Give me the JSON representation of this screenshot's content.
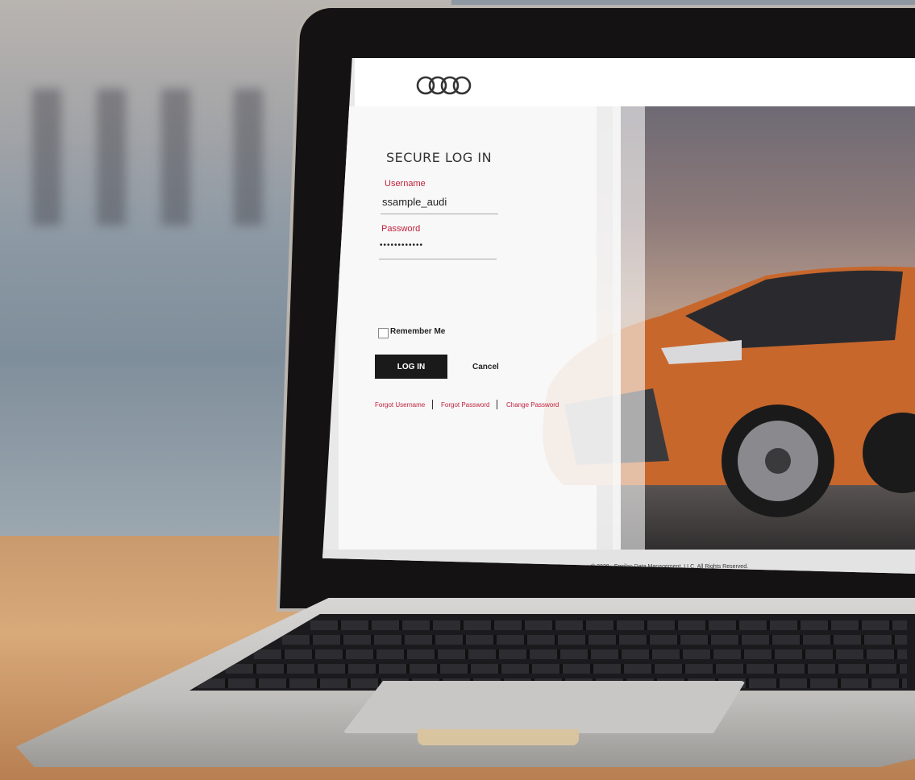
{
  "app": {
    "brand_logo_icon": "four-rings-logo-icon"
  },
  "login": {
    "title": "SECURE LOG IN",
    "username_label": "Username",
    "username_value": "ssample_audi",
    "password_label": "Password",
    "password_value": "••••••••••••",
    "remember_label": "Remember Me",
    "login_button": "LOG IN",
    "cancel_button": "Cancel",
    "links": {
      "forgot_username": "Forgot Username",
      "forgot_password": "Forgot Password",
      "change_password": "Change Password"
    }
  },
  "footer": {
    "copyright": "© 2020 · Epsilon Data Management, LLC. All Rights Reserved."
  },
  "colors": {
    "accent": "#c0223c",
    "button": "#1a1a1a",
    "car": "#c8672c"
  }
}
